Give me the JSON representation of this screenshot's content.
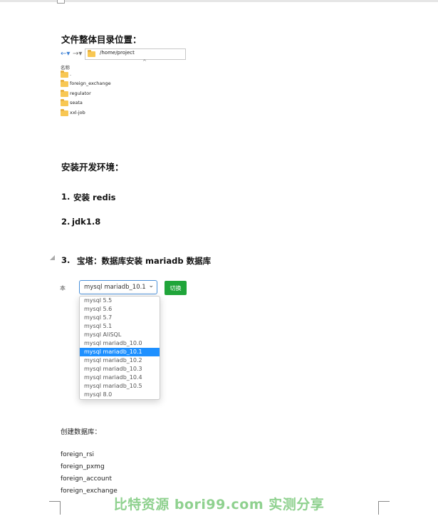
{
  "headings": {
    "dir": "文件整体目录位置：",
    "env": "安装开发环境："
  },
  "explorer": {
    "path": "/home/project",
    "column_header": "名称",
    "folders": [
      ".",
      "foreign_exchange",
      "regulator",
      "seata",
      "xxl-job"
    ]
  },
  "steps": [
    {
      "num": "1.",
      "text": "安装 redis"
    },
    {
      "num": "2.",
      "text": "jdk1.8"
    },
    {
      "num": "3.",
      "text": "宝塔：数据库安装 mariadb 数据库"
    }
  ],
  "bt_panel": {
    "label_fragment": "本",
    "selected": "mysql mariadb_10.1",
    "switch_label": "切换",
    "options": [
      "mysql 5.5",
      "mysql 5.6",
      "mysql 5.7",
      "mysql 5.1",
      "mysql AliSQL",
      "mysql mariadb_10.0",
      "mysql mariadb_10.1",
      "mysql mariadb_10.2",
      "mysql mariadb_10.3",
      "mysql mariadb_10.4",
      "mysql mariadb_10.5",
      "mysql 8.0"
    ],
    "selected_index": 6,
    "highlight_color": "#1e90ff",
    "button_color": "#20a53a"
  },
  "databases": {
    "intro": "创建数据库：",
    "names": [
      "foreign_rsi",
      "foreign_pxmg",
      "foreign_account",
      "foreign_exchange"
    ]
  },
  "watermark": "比特资源 bori99.com 实测分享"
}
